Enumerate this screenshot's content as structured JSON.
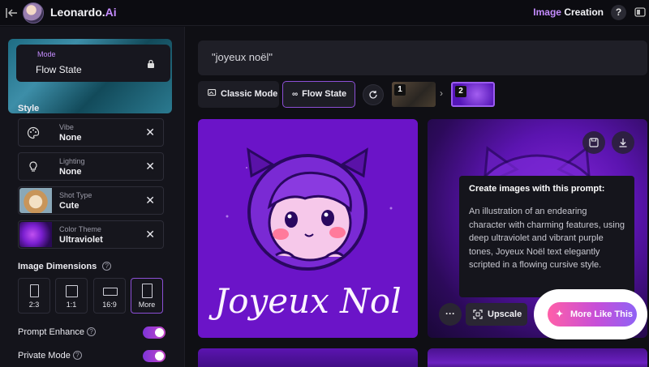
{
  "topbar": {
    "brand_main": "Leonardo.",
    "brand_ai": "Ai",
    "title_image": "Image",
    "title_creation": "Creation",
    "help": "?"
  },
  "sidebar": {
    "mode": {
      "label": "Mode",
      "value": "Flow State"
    },
    "style_title": "Style",
    "style_rows": [
      {
        "label": "Vibe",
        "value": "None",
        "icon": "palette-icon"
      },
      {
        "label": "Lighting",
        "value": "None",
        "icon": "lightbulb-icon"
      },
      {
        "label": "Shot Type",
        "value": "Cute",
        "icon": "cat-thumbnail"
      },
      {
        "label": "Color Theme",
        "value": "Ultraviolet",
        "icon": "ultraviolet-thumbnail"
      }
    ],
    "dimensions_title": "Image Dimensions",
    "dimensions": [
      {
        "label": "2:3",
        "active": false
      },
      {
        "label": "1:1",
        "active": false
      },
      {
        "label": "16:9",
        "active": false
      },
      {
        "label": "More",
        "active": true
      }
    ],
    "toggles": [
      {
        "label": "Prompt Enhance",
        "on": true
      },
      {
        "label": "Private Mode",
        "on": true
      }
    ]
  },
  "main": {
    "prompt": "\"joyeux noël\"",
    "modes": {
      "classic": "Classic Mode",
      "flow": "Flow State"
    },
    "history": [
      {
        "num": "1"
      },
      {
        "num": "2"
      }
    ],
    "card1_text": "Joyeux Nol",
    "tooltip": {
      "title": "Create images with this prompt:",
      "body": "An illustration of an endearing character with charming features, using deep ultraviolet and vibrant purple tones, Joyeux Noël text elegantly scripted in a flowing cursive style."
    },
    "actions": {
      "more": "···",
      "upscale": "Upscale",
      "more_like": "More Like This"
    }
  },
  "colors": {
    "accent": "#c58cff",
    "active_border": "#8c4fd6",
    "card_purple": "#6b14c8",
    "more_like_gradient": [
      "#ff5fa8",
      "#c64fd8",
      "#8f62f5"
    ]
  }
}
